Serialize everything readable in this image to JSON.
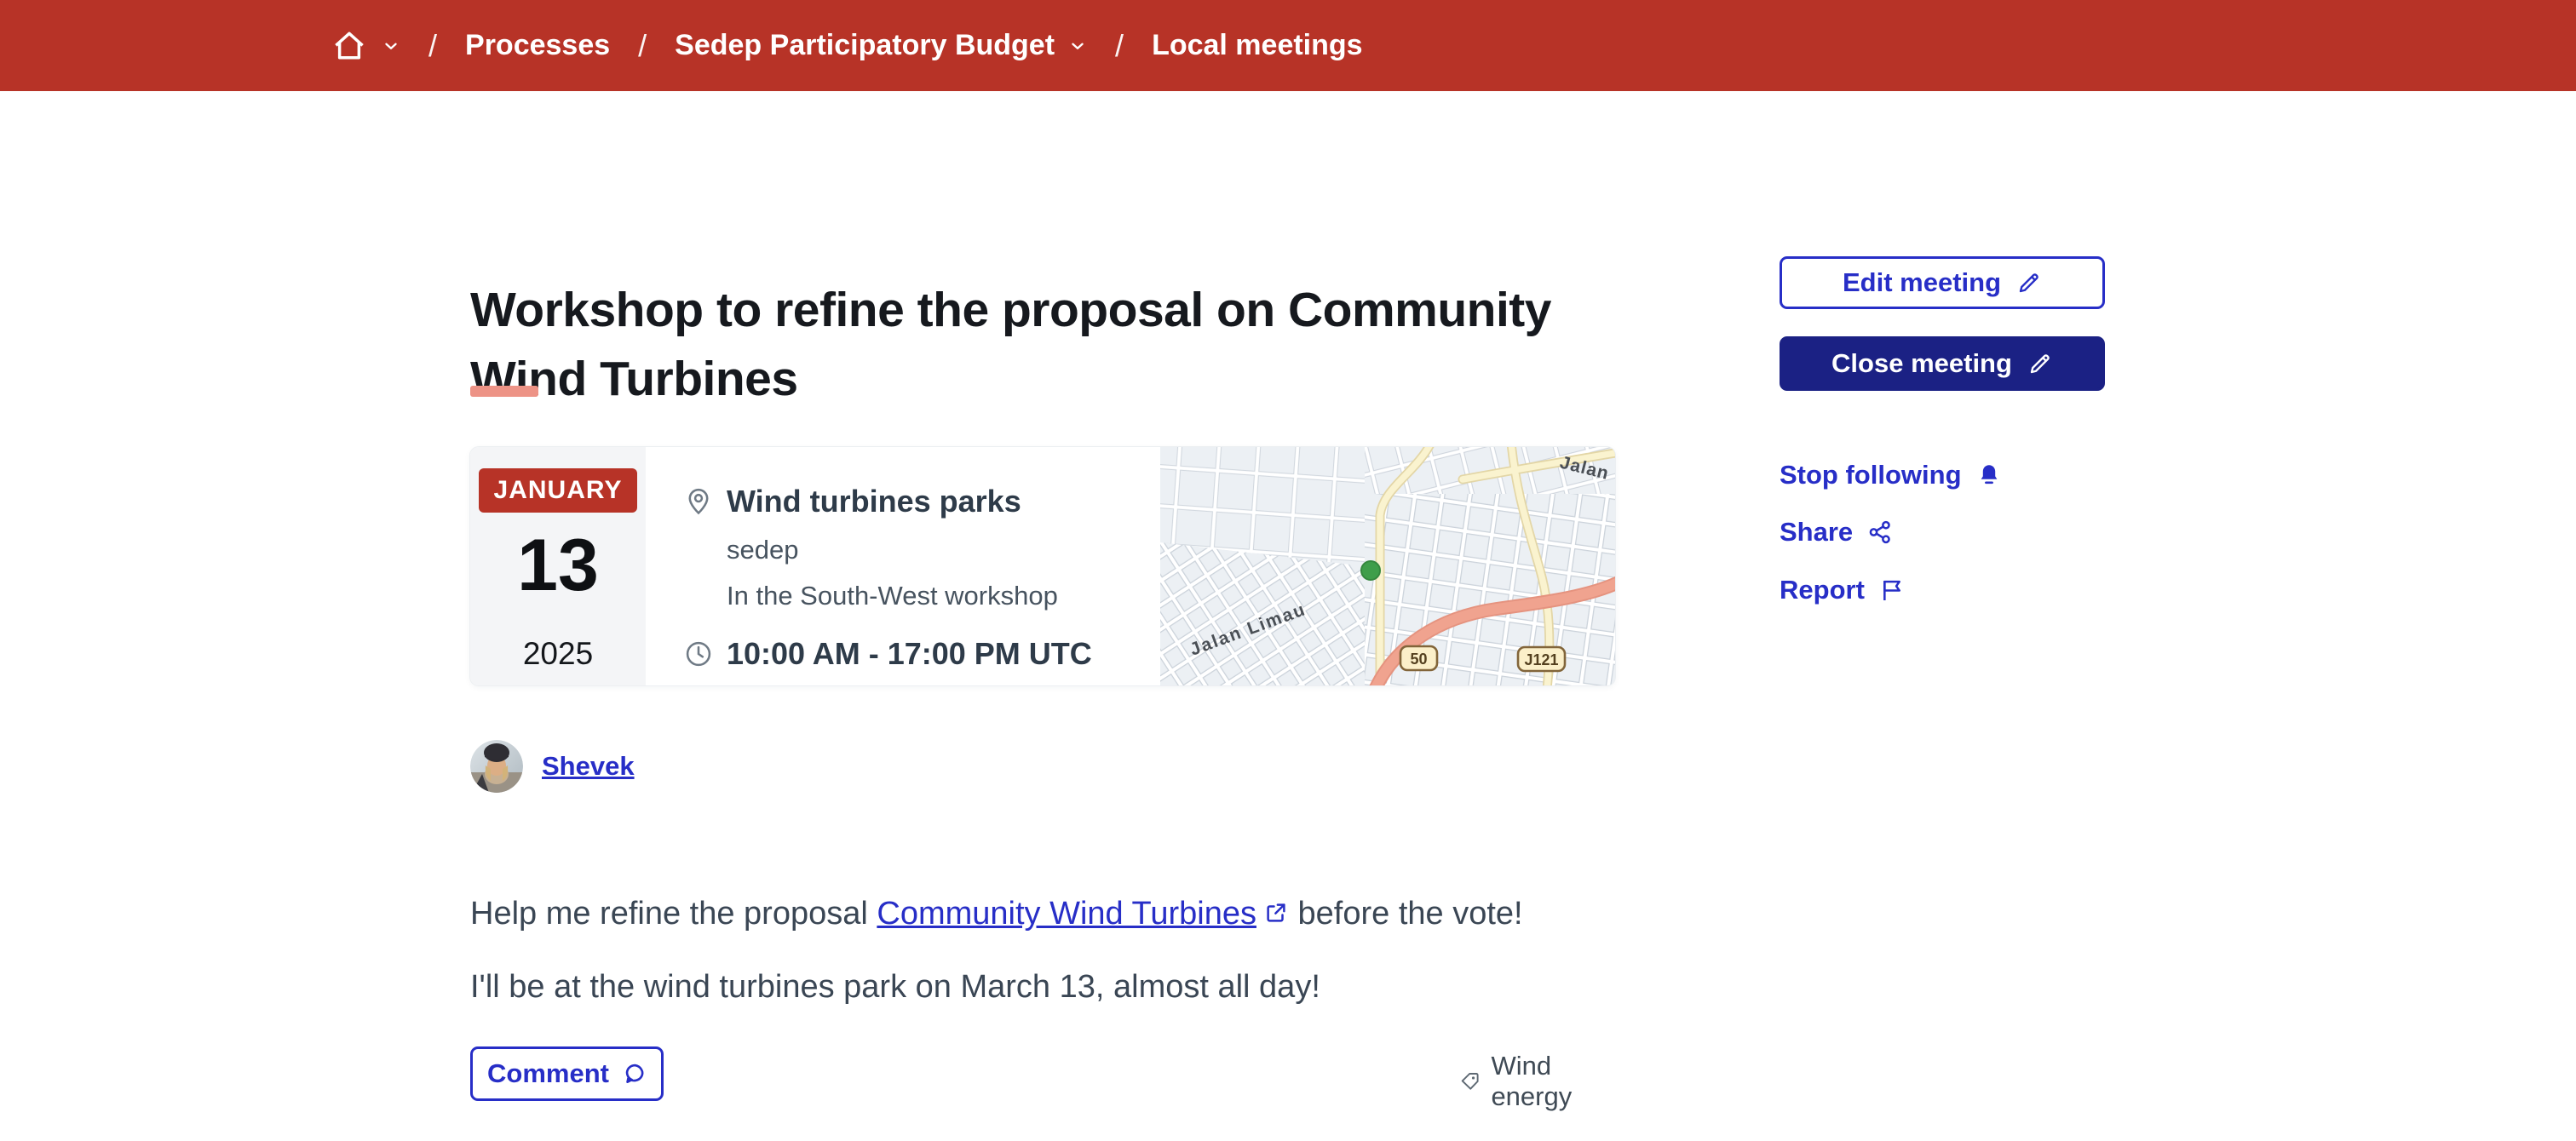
{
  "breadcrumb": {
    "separator": "/",
    "processes": "Processes",
    "process_name": "Sedep Participatory Budget",
    "section": "Local meetings"
  },
  "meeting": {
    "title": "Workshop to refine the proposal on Community Wind Turbines",
    "date": {
      "month": "JANUARY",
      "day": "13",
      "year": "2025"
    },
    "location": {
      "name": "Wind turbines parks",
      "organization": "sedep",
      "address": "In the South-West workshop"
    },
    "time": "10:00 AM - 17:00 PM UTC",
    "author": {
      "name": "Shevek"
    },
    "body": {
      "p1_prefix": "Help me refine the proposal ",
      "p1_link": "Community Wind Turbines",
      "p1_suffix": " before the vote!",
      "p2": "I'll be at the wind turbines park on March 13, almost all day!"
    },
    "tag": "Wind energy"
  },
  "actions": {
    "edit": "Edit meeting",
    "close": "Close meeting",
    "stop_following": "Stop following",
    "share": "Share",
    "report": "Report",
    "comment": "Comment"
  },
  "map": {
    "street_label": "Jalan  Limau",
    "partial_label": "Jalan",
    "shield_1": "50",
    "shield_2": "J121"
  },
  "colors": {
    "header_red": "#B73327",
    "accent_blue": "#272EC7",
    "button_navy": "#1B2184",
    "title_underline": "#ED9386",
    "marker_green": "#3F9E4A"
  }
}
